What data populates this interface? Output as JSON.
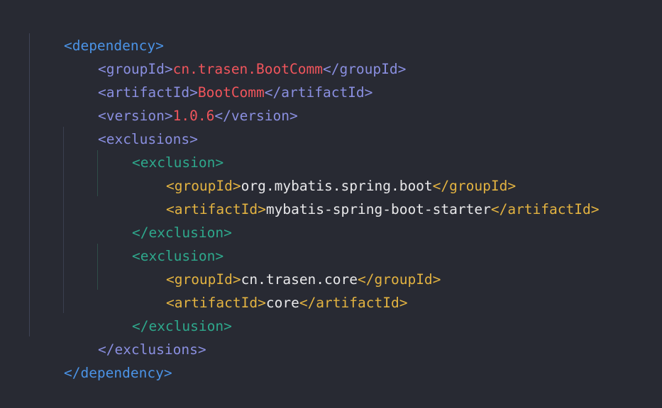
{
  "code": {
    "l1_open": "<dependency>",
    "l2_open": "<groupId>",
    "l2_value": "cn.trasen.BootComm",
    "l2_close": "</groupId>",
    "l3_open": "<artifactId>",
    "l3_value": "BootComm",
    "l3_close": "</artifactId>",
    "l4_open": "<version>",
    "l4_value": "1.0.6",
    "l4_close": "</version>",
    "l5_open": "<exclusions>",
    "l6_open": "<exclusion>",
    "l7_open": "<groupId>",
    "l7_value": "org.mybatis.spring.boot",
    "l7_close": "</groupId>",
    "l8_open": "<artifactId>",
    "l8_value": "mybatis-spring-boot-starter",
    "l8_close": "</artifactId>",
    "l9_close": "</exclusion>",
    "l10_open": "<exclusion>",
    "l11_open": "<groupId>",
    "l11_value": "cn.trasen.core",
    "l11_close": "</groupId>",
    "l12_open": "<artifactId>",
    "l12_value": "core",
    "l12_close": "</artifactId>",
    "l13_close": "</exclusion>",
    "l14_close": "</exclusions>",
    "l15_close": "</dependency>"
  },
  "colors": {
    "background": "#282a33",
    "level1_tag": "#4b93e6",
    "level2_tag": "#8a8fe0",
    "level3_tag": "#2ea88c",
    "level4_tag": "#e3b341",
    "level2_value": "#f0555c",
    "level4_value": "#e8e8ea"
  }
}
